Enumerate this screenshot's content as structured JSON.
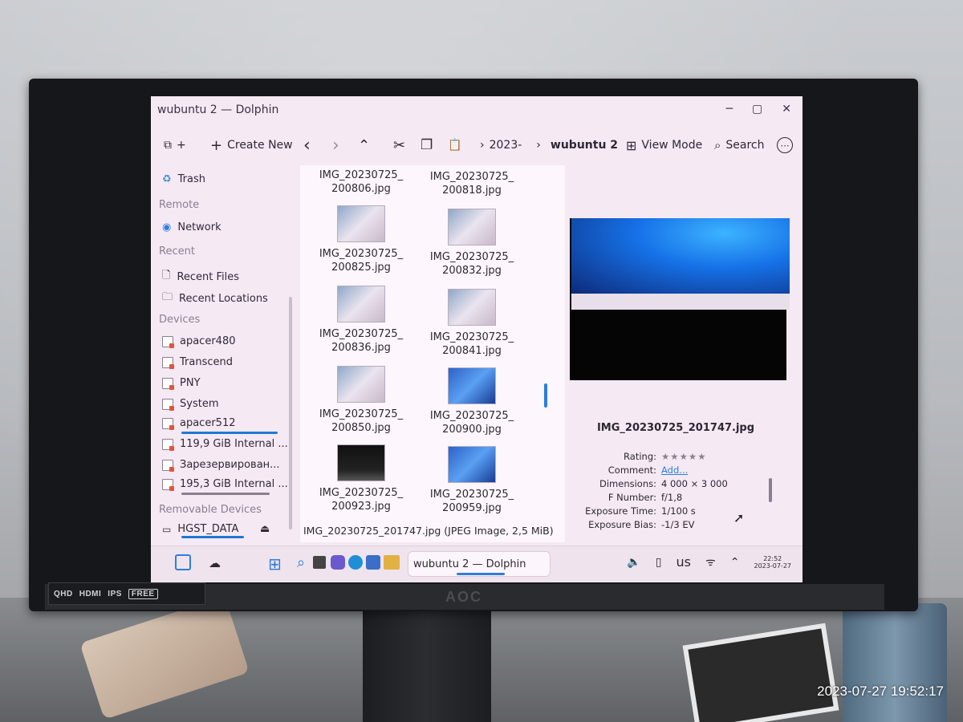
{
  "window": {
    "title": "wubuntu 2 — Dolphin",
    "min": "─",
    "max": "▢",
    "close": "✕"
  },
  "toolbar": {
    "new_tab_icon": "⧉",
    "plus": "+",
    "create_new": "Create New",
    "back": "‹",
    "forward": "›",
    "up": "⌃",
    "cut": "✂",
    "copy": "❐",
    "paste": "📋",
    "crumb_parent": "2023-",
    "crumb_current": "wubuntu 2",
    "view_mode": "View Mode",
    "search": "Search",
    "more": "⋯"
  },
  "sidebar": {
    "trash": "Trash",
    "remote_header": "Remote",
    "network": "Network",
    "recent_header": "Recent",
    "recent_files": "Recent Files",
    "recent_locations": "Recent Locations",
    "devices_header": "Devices",
    "devices": [
      "apacer480",
      "Transcend",
      "PNY",
      "System",
      "apacer512",
      "119,9 GiB Internal ...",
      "Зарезервирован...",
      "195,3 GiB Internal ..."
    ],
    "removable_header": "Removable Devices",
    "removable": [
      "HGST_DATA"
    ],
    "eject": "⏏"
  },
  "files": [
    {
      "l1": "IMG_20230725_",
      "l2": "200806.jpg",
      "thumb": "none"
    },
    {
      "l1": "IMG_20230725_",
      "l2": "200818.jpg",
      "thumb": "none"
    },
    {
      "l1": "IMG_20230725_",
      "l2": "200825.jpg",
      "thumb": "screen"
    },
    {
      "l1": "IMG_20230725_",
      "l2": "200832.jpg",
      "thumb": "screen"
    },
    {
      "l1": "IMG_20230725_",
      "l2": "200836.jpg",
      "thumb": "screen"
    },
    {
      "l1": "IMG_20230725_",
      "l2": "200841.jpg",
      "thumb": "screen"
    },
    {
      "l1": "IMG_20230725_",
      "l2": "200850.jpg",
      "thumb": "screen"
    },
    {
      "l1": "IMG_20230725_",
      "l2": "200900.jpg",
      "thumb": "blue"
    },
    {
      "l1": "IMG_20230725_",
      "l2": "200923.jpg",
      "thumb": "dark"
    },
    {
      "l1": "IMG_20230725_",
      "l2": "200959.jpg",
      "thumb": "blue"
    }
  ],
  "status": "IMG_20230725_201747.jpg (JPEG Image, 2,5 MiB)",
  "info": {
    "name": "IMG_20230725_201747.jpg",
    "rating_label": "Rating:",
    "rating_stars": "★★★★★",
    "comment_label": "Comment:",
    "comment_value": "Add...",
    "dimensions_label": "Dimensions:",
    "dimensions_value": "4 000 × 3 000",
    "fnumber_label": "F Number:",
    "fnumber_value": "f/1,8",
    "exposure_time_label": "Exposure Time:",
    "exposure_time_value": "1/100 s",
    "exposure_bias_label": "Exposure Bias:",
    "exposure_bias_value": "-1/3 EV"
  },
  "taskbar": {
    "active_window": "wubuntu 2 — Dolphin",
    "keyboard": "us",
    "clock_time": "22:52",
    "clock_date": "2023-07-27"
  },
  "monitor": {
    "badges": [
      "QHD",
      "HDMI",
      "IPS",
      "FREE"
    ],
    "brand": "AOC"
  },
  "photo_timestamp": "2023-07-27 19:52:17",
  "colors": {
    "accent": "#2d7fdb",
    "window_bg": "#f5e9f4"
  }
}
